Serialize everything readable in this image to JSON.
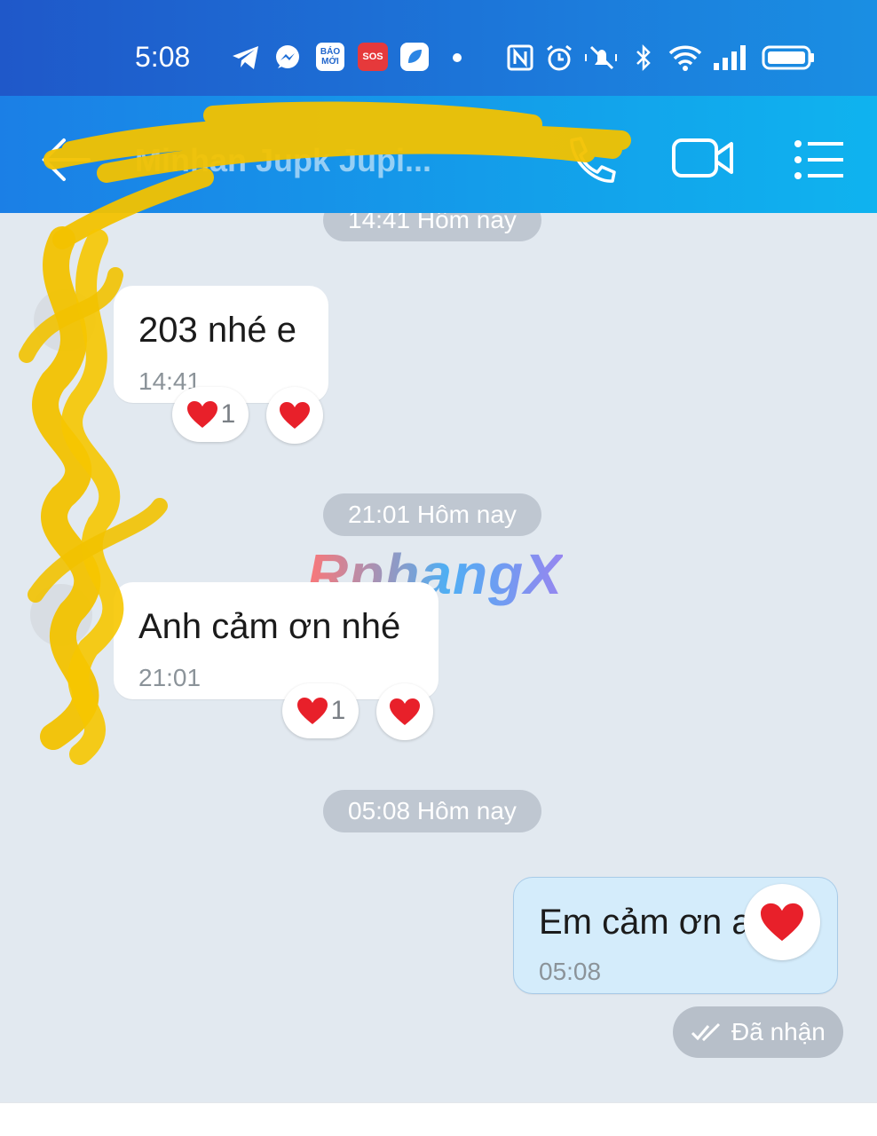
{
  "status_bar": {
    "time": "5:08",
    "icons": [
      "telegram-icon",
      "messenger-icon",
      "bao-moi-icon",
      "sos-icon",
      "app-icon",
      "dot-icon",
      "nfc-icon",
      "alarm-icon",
      "mute-icon",
      "bluetooth-icon",
      "wifi-icon",
      "signal-icon",
      "battery-icon"
    ],
    "bao_moi_label": "BÁO MỚI",
    "sos_label": "SOS"
  },
  "header": {
    "contact_name": "Minhan Jupk Jupi...",
    "icons": [
      "back-arrow-icon",
      "phone-icon",
      "video-call-icon",
      "menu-icon"
    ]
  },
  "messages": {
    "groups": [
      {
        "timestamp": "14:41 Hôm nay",
        "text": "203 nhé e",
        "time": "14:41",
        "reaction_count": "1"
      },
      {
        "timestamp": "21:01 Hôm nay",
        "text": "Anh cảm ơn nhé",
        "time": "21:01",
        "reaction_count": "1"
      },
      {
        "timestamp": "05:08 Hôm nay",
        "text": "Em cảm ơn anh!",
        "time": "05:08",
        "status": "Đã nhận"
      }
    ],
    "watermark": "RphangX"
  },
  "colors": {
    "header_start": "#1b7fe6",
    "header_end": "#0fb3ef",
    "chat_bg": "#e2e9f0",
    "outgoing_bubble": "#d4ecfb",
    "heart": "#e8202a"
  }
}
